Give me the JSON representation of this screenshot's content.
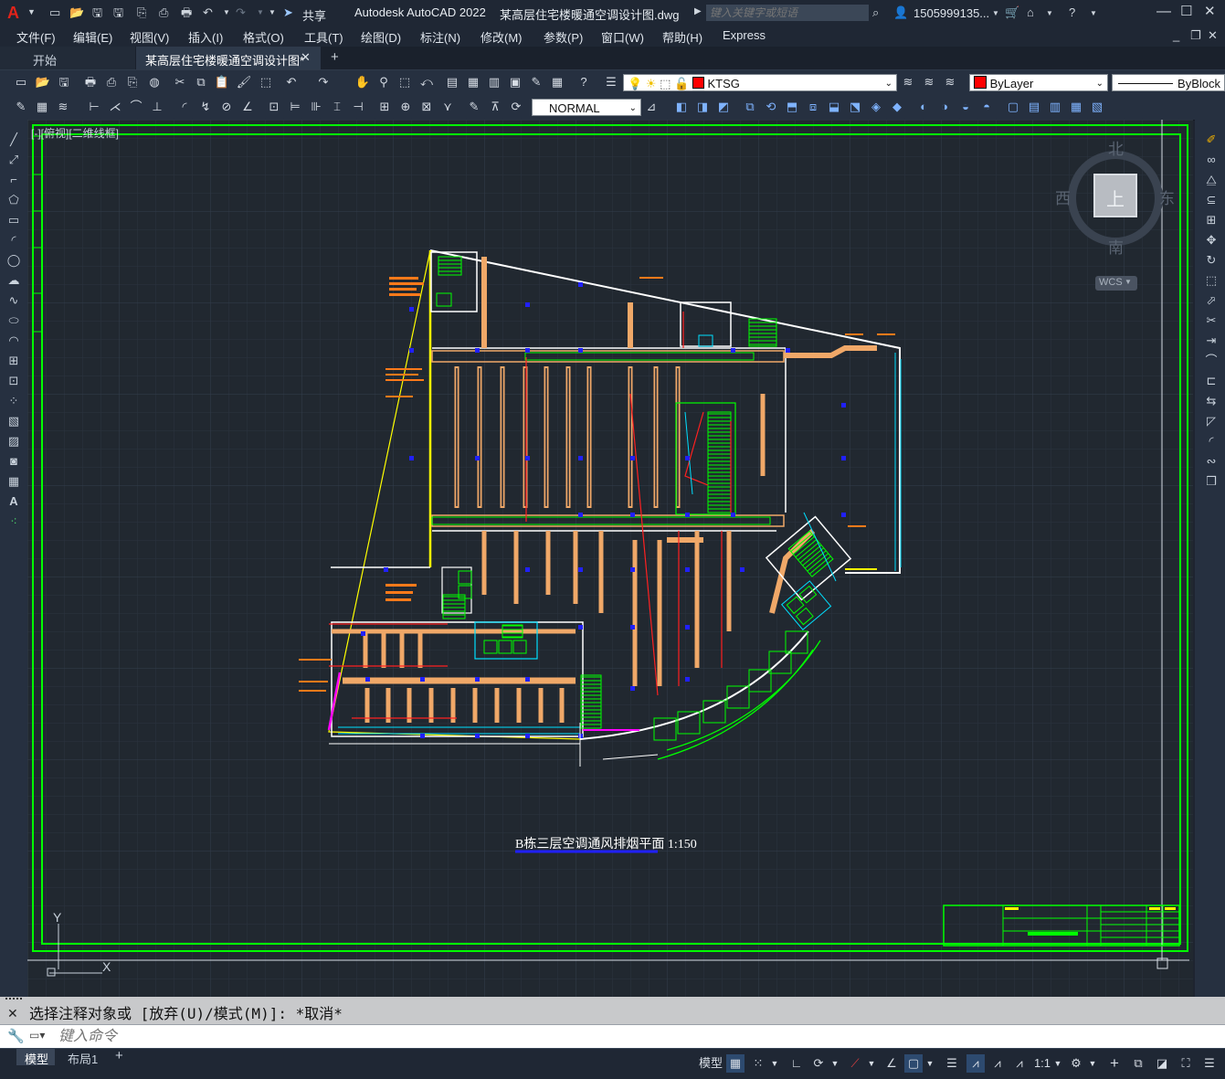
{
  "titlebar": {
    "app_logo": "A",
    "share_label": "共享",
    "app_title": "Autodesk AutoCAD 2022",
    "file_title": "某高层住宅楼暖通空调设计图.dwg",
    "search_placeholder": "键入关键字或短语",
    "user_name": "1505999135..."
  },
  "menu": {
    "items": [
      "文件(F)",
      "编辑(E)",
      "视图(V)",
      "插入(I)",
      "格式(O)",
      "工具(T)",
      "绘图(D)",
      "标注(N)",
      "修改(M)",
      "参数(P)",
      "窗口(W)",
      "帮助(H)",
      "Express"
    ]
  },
  "tabs": {
    "start": "开始",
    "active_doc": "某高层住宅楼暖通空调设计图*",
    "close": "✕",
    "add": "+"
  },
  "toolbar": {
    "layer_value": "KTSG",
    "color_value": "ByLayer",
    "linetype_value": "ByBlock",
    "style_value": "NORMAL",
    "layer_color": "#ff0000"
  },
  "viewport": {
    "label": "[-][俯视][二维线框]"
  },
  "viewcube": {
    "north": "北",
    "south": "南",
    "east": "东",
    "west": "西",
    "face": "上",
    "wcs": "WCS"
  },
  "drawing": {
    "caption": "B栋三层空调通风排烟平面 1:150",
    "ucs_y": "Y",
    "ucs_x": "X"
  },
  "command": {
    "history": "选择注释对象或 [放弃(U)/模式(M)]: *取消*",
    "placeholder": "键入命令"
  },
  "status": {
    "tab_model": "模型",
    "tab_layout": "布局1",
    "add_layout": "+",
    "model_label": "模型",
    "scale": "1:1"
  },
  "colors": {
    "frame_green": "#00ff00",
    "duct_orange": "#f0a868",
    "wall_white": "#ffffff",
    "marker_blue": "#1a1aff",
    "annotation_yellow": "#ffff00",
    "cyan": "#00e0ff",
    "magenta": "#ff00ff",
    "red": "#ff2020"
  }
}
